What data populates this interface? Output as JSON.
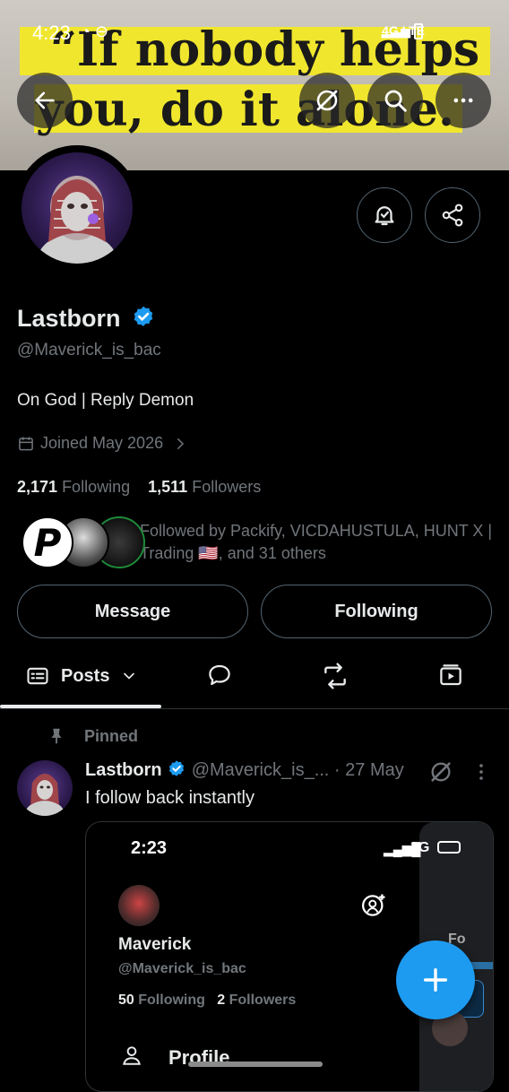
{
  "status_bar": {
    "time": "4:23",
    "network": "4G LTE"
  },
  "banner": {
    "line1": "“If nobody helps",
    "line2": "you, do it alone."
  },
  "profile": {
    "name": "Lastborn",
    "handle": "@Maverick_is_bac",
    "bio": "On God | Reply Demon",
    "joined": "Joined May 2026",
    "following_count": "2,171",
    "following_label": "Following",
    "followers_count": "1,511",
    "followers_label": "Followers",
    "followed_by": "Followed by Packify, VICDAHUSTULA, HUNT X | Trading 🇺🇸, and 31 others"
  },
  "actions": {
    "message": "Message",
    "following": "Following"
  },
  "tabs": {
    "posts": "Posts"
  },
  "pinned_post": {
    "pinned_label": "Pinned",
    "author": "Lastborn",
    "handle": "@Maverick_is_...",
    "time": "· 27 May",
    "text": "I follow back instantly"
  },
  "embedded_screenshot": {
    "time": "2:23",
    "network": "3G",
    "name": "Maverick",
    "handle": "@Maverick_is_bac",
    "following_count": "50",
    "following_label": "Following",
    "followers_count": "2",
    "followers_label": "Followers",
    "menu_profile": "Profile",
    "side_text": "Fo"
  },
  "colors": {
    "accent": "#1d9bf0",
    "verified": "#1d9bf0",
    "background": "#000000"
  }
}
